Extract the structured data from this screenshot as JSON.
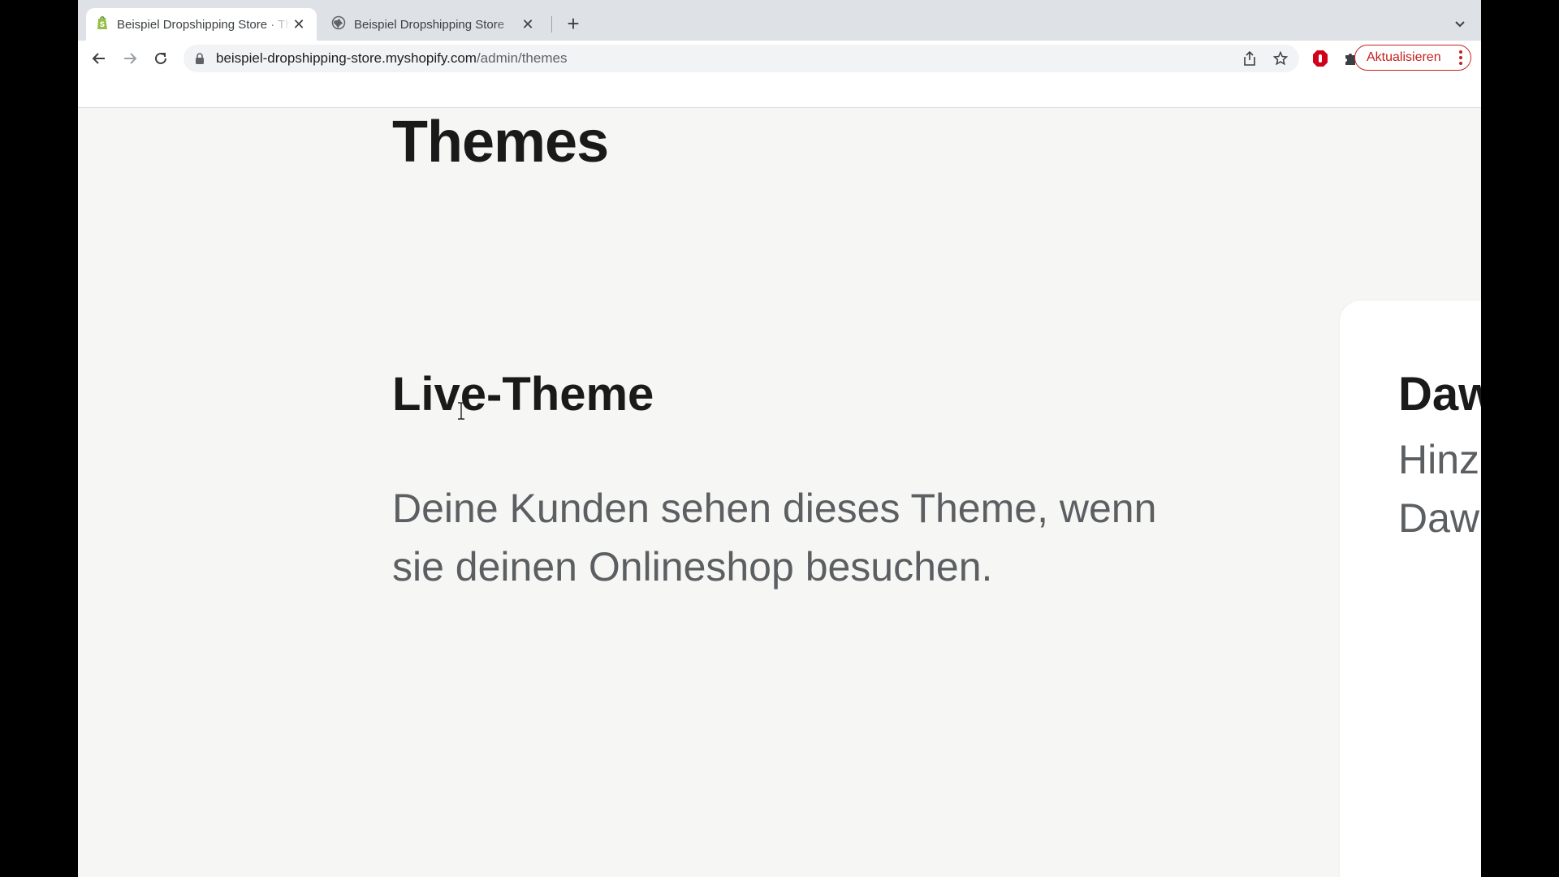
{
  "tabs": [
    {
      "title": "Beispiel Dropshipping Store · Themes",
      "icon": "shopify-icon",
      "active": true
    },
    {
      "title": "Beispiel Dropshipping Store",
      "icon": "globe-icon",
      "active": false
    }
  ],
  "new_tab_symbol": "+",
  "toolbar": {
    "url_host": "beispiel-dropshipping-store.myshopify.com",
    "url_path": "/admin/themes",
    "update_label": "Aktualisieren"
  },
  "page": {
    "title": "Themes",
    "live_section": {
      "title": "Live-Theme",
      "description": "Deine Kunden sehen dieses Theme, wenn sie deinen Onlineshop besuchen."
    },
    "theme_card": {
      "title": "Dawn",
      "description_line1": "Hinzugefügt",
      "description_line2": "Dawn"
    }
  },
  "colors": {
    "accent_update": "#c5221f",
    "page_bg": "#f6f6f4",
    "shopify_green": "#95bf47"
  }
}
